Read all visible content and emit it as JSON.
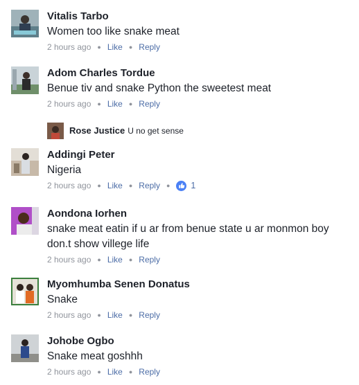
{
  "time_label": "2 hours ago",
  "like_label": "Like",
  "reply_label": "Reply",
  "comments": [
    {
      "author": "Vitalis Tarbo",
      "lines": [
        "Women too like snake meat"
      ]
    },
    {
      "author": "Adom Charles Tordue",
      "lines": [
        "Benue tiv and snake Python the sweetest meat"
      ]
    },
    {
      "author": "Addingi Peter",
      "lines": [
        "Nigeria"
      ],
      "reaction_count": "1"
    },
    {
      "author": "Aondona Iorhen",
      "lines": [
        "snake meat eatin if u ar from benue state u ar monmon boy",
        "don.t show villege life"
      ]
    },
    {
      "author": "Myomhumba Senen Donatus",
      "lines": [
        "Snake"
      ]
    },
    {
      "author": "Johobe Ogbo",
      "lines": [
        "Snake meat goshhh"
      ]
    }
  ],
  "reply": {
    "author": "Rose Justice",
    "text": "U no get sense"
  },
  "colors": {
    "link": "#4b6ca6",
    "meta_text": "#90949c",
    "name_text": "#1d2129",
    "like_badge": "#4a80f5"
  },
  "icons": {
    "reaction": "thumbs-up-icon"
  }
}
